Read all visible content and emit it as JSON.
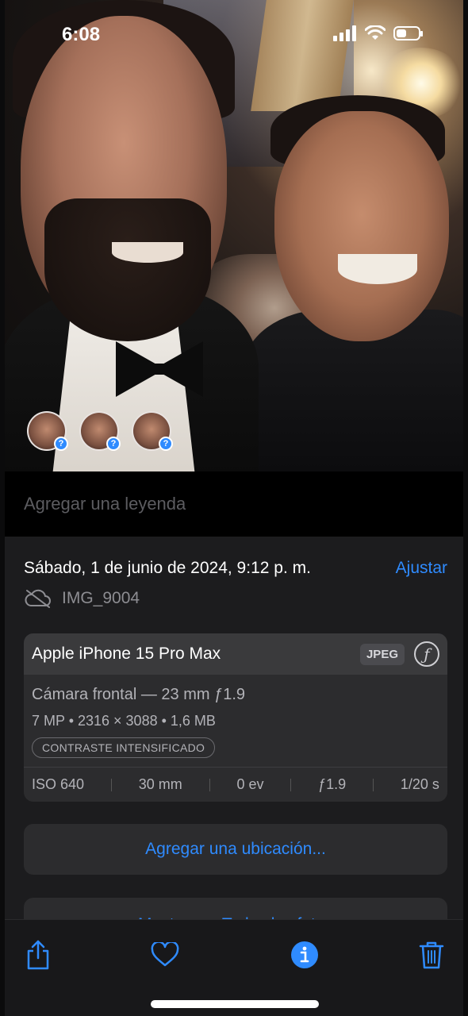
{
  "status_bar": {
    "time": "6:08"
  },
  "photo": {
    "face_badge": "?"
  },
  "caption": {
    "placeholder": "Agregar una leyenda"
  },
  "info": {
    "date": "Sábado, 1 de junio de 2024, 9:12 p. m.",
    "adjust_label": "Ajustar",
    "filename": "IMG_9004",
    "device": "Apple iPhone 15 Pro Max",
    "format": "JPEG",
    "lens": "Cámara frontal — 23 mm ƒ1.9",
    "specs": "7 MP • 2316 × 3088 • 1,6 MB",
    "badge": "CONTRASTE INTENSIFICADO",
    "exif": {
      "iso": "ISO 640",
      "focal": "30 mm",
      "ev": "0 ev",
      "aperture": "ƒ1.9",
      "shutter": "1/20 s"
    },
    "add_location": "Agregar una ubicación...",
    "show_in_all": "Mostrar en Todas las fotos"
  },
  "colors": {
    "accent": "#2f8bff",
    "panel": "#1c1c1e",
    "card": "#2c2c2e"
  },
  "icons": [
    "signal-icon",
    "wifi-icon",
    "battery-icon",
    "cloud-off-icon",
    "f-icon",
    "share-icon",
    "heart-icon",
    "info-icon",
    "trash-icon"
  ],
  "battery_level": 0.45
}
